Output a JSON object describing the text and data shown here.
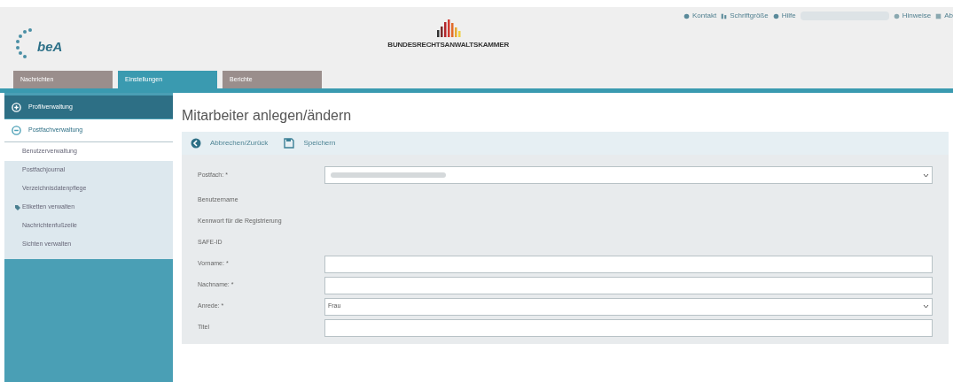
{
  "header": {
    "links": [
      {
        "label": "Kontakt",
        "kind": "contact"
      },
      {
        "label": "Schriftgröße",
        "kind": "font"
      },
      {
        "label": "Hilfe",
        "kind": "help"
      }
    ],
    "user_links": [
      {
        "label": "Hinweise",
        "kind": "info"
      },
      {
        "label": "Ab",
        "kind": "logout"
      }
    ],
    "logo": {
      "text": "beA"
    },
    "org_name": "BUNDESRECHTSANWALTSKAMMER"
  },
  "tabs": [
    {
      "label": "Nachrichten",
      "selected": false
    },
    {
      "label": "Einstellungen",
      "selected": true
    },
    {
      "label": "Berichte",
      "selected": false
    }
  ],
  "sidebar": {
    "sections": [
      {
        "label": "Profilverwaltung",
        "expanded": false
      },
      {
        "label": "Postfachverwaltung",
        "expanded": true,
        "children": [
          {
            "label": "Benutzerverwaltung",
            "selected": true
          },
          {
            "label": "Postfachjournal",
            "selected": false
          },
          {
            "label": "Verzeichnisdatenpflege",
            "selected": false
          },
          {
            "label": "Etiketten verwalten",
            "selected": false,
            "kind": "tag"
          },
          {
            "label": "Nachrichtenfußzeile",
            "selected": false
          },
          {
            "label": "Sichten verwalten",
            "selected": false
          }
        ]
      }
    ]
  },
  "page": {
    "title": "Mitarbeiter anlegen/ändern",
    "toolbar": [
      {
        "label": "Abbrechen/Zurück",
        "kind": "back"
      },
      {
        "label": "Speichern",
        "kind": "save"
      }
    ],
    "fields": [
      {
        "label": "Postfach: *",
        "kind": "select"
      },
      {
        "label": "Benutzername",
        "kind": "static"
      },
      {
        "label": "Kennwort für die Registrierung",
        "kind": "static"
      },
      {
        "label": "SAFE-ID",
        "kind": "static"
      },
      {
        "label": "Vorname: *",
        "kind": "input"
      },
      {
        "label": "Nachname: *",
        "kind": "input"
      },
      {
        "label": "Anrede: *",
        "kind": "select",
        "value": "Frau"
      },
      {
        "label": "Titel",
        "kind": "input"
      }
    ]
  }
}
